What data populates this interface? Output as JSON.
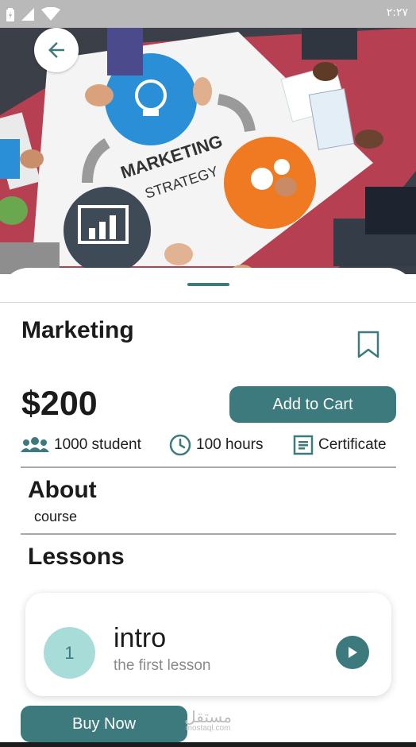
{
  "status_bar": {
    "time": "٢:٢٧"
  },
  "hero": {
    "image": "marketing-strategy-photo",
    "text_line1": "MARKETING",
    "text_line2": "STRATEGY"
  },
  "course": {
    "title": "Marketing",
    "price": "$200",
    "add_to_cart_label": "Add to Cart",
    "stats": {
      "students": "1000 student",
      "hours": "100 hours",
      "certificate": "Certificate"
    }
  },
  "about": {
    "heading": "About",
    "text": "course"
  },
  "lessons": {
    "heading": "Lessons",
    "items": [
      {
        "number": "1",
        "title": "intro",
        "subtitle": "the first lesson"
      }
    ]
  },
  "buy_now_label": "Buy Now",
  "watermark": {
    "arabic": "مستقل",
    "latin": "mostaql.com"
  },
  "colors": {
    "accent": "#3d7a7d",
    "lesson_badge": "#a8dcd9",
    "status_bar": "#b9b9b9"
  },
  "icons": [
    "wifi-icon",
    "signal-icon",
    "battery-icon",
    "back-arrow-icon",
    "bookmark-icon",
    "group-icon",
    "clock-icon",
    "certificate-icon",
    "play-icon"
  ]
}
